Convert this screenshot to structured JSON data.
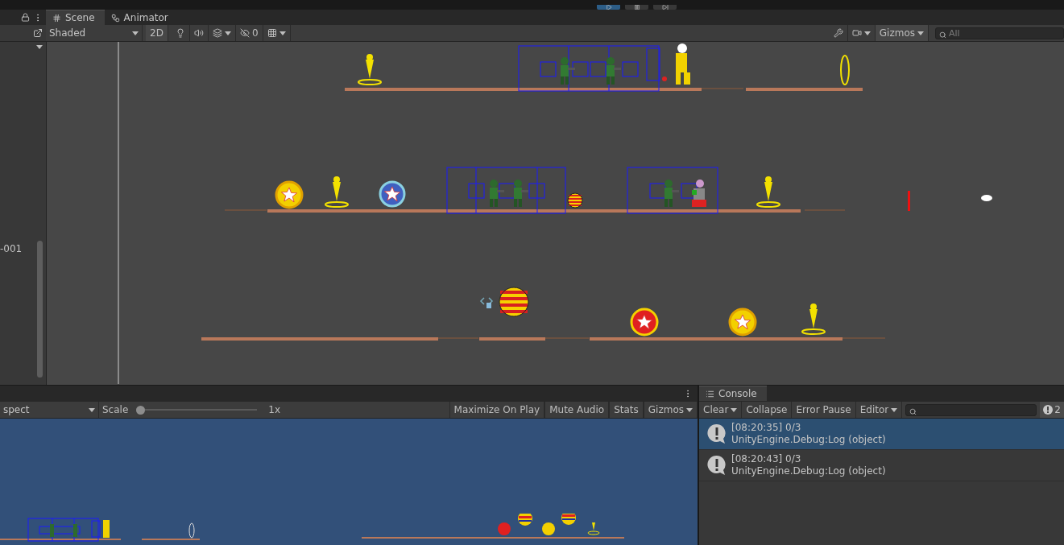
{
  "scene_tabs": [
    {
      "label": "Scene",
      "selected": true
    },
    {
      "label": "Animator",
      "selected": false
    }
  ],
  "scene_toolbar": {
    "shading": "Shaded",
    "mode_button": "2D",
    "hidden_count": "0",
    "gizmos": "Gizmos",
    "search": {
      "placeholder": "All"
    }
  },
  "hierarchy": {
    "item": "-001"
  },
  "game_toolbar": {
    "aspect": "spect",
    "scale_label": "Scale",
    "scale": {
      "level": 0
    },
    "scale_value": "1x",
    "buttons": [
      "Maximize On Play",
      "Mute Audio",
      "Stats",
      "Gizmos"
    ]
  },
  "console": {
    "title": "Console",
    "buttons": [
      "Clear",
      "Collapse",
      "Error Pause",
      "Editor"
    ],
    "message_count": "2",
    "entries": [
      {
        "header": "[08:20:35] 0/3",
        "detail": "UnityEngine.Debug:Log (object)",
        "selected": true
      },
      {
        "header": "[08:20:43] 0/3",
        "detail": "UnityEngine.Debug:Log (object)",
        "selected": false
      }
    ]
  }
}
